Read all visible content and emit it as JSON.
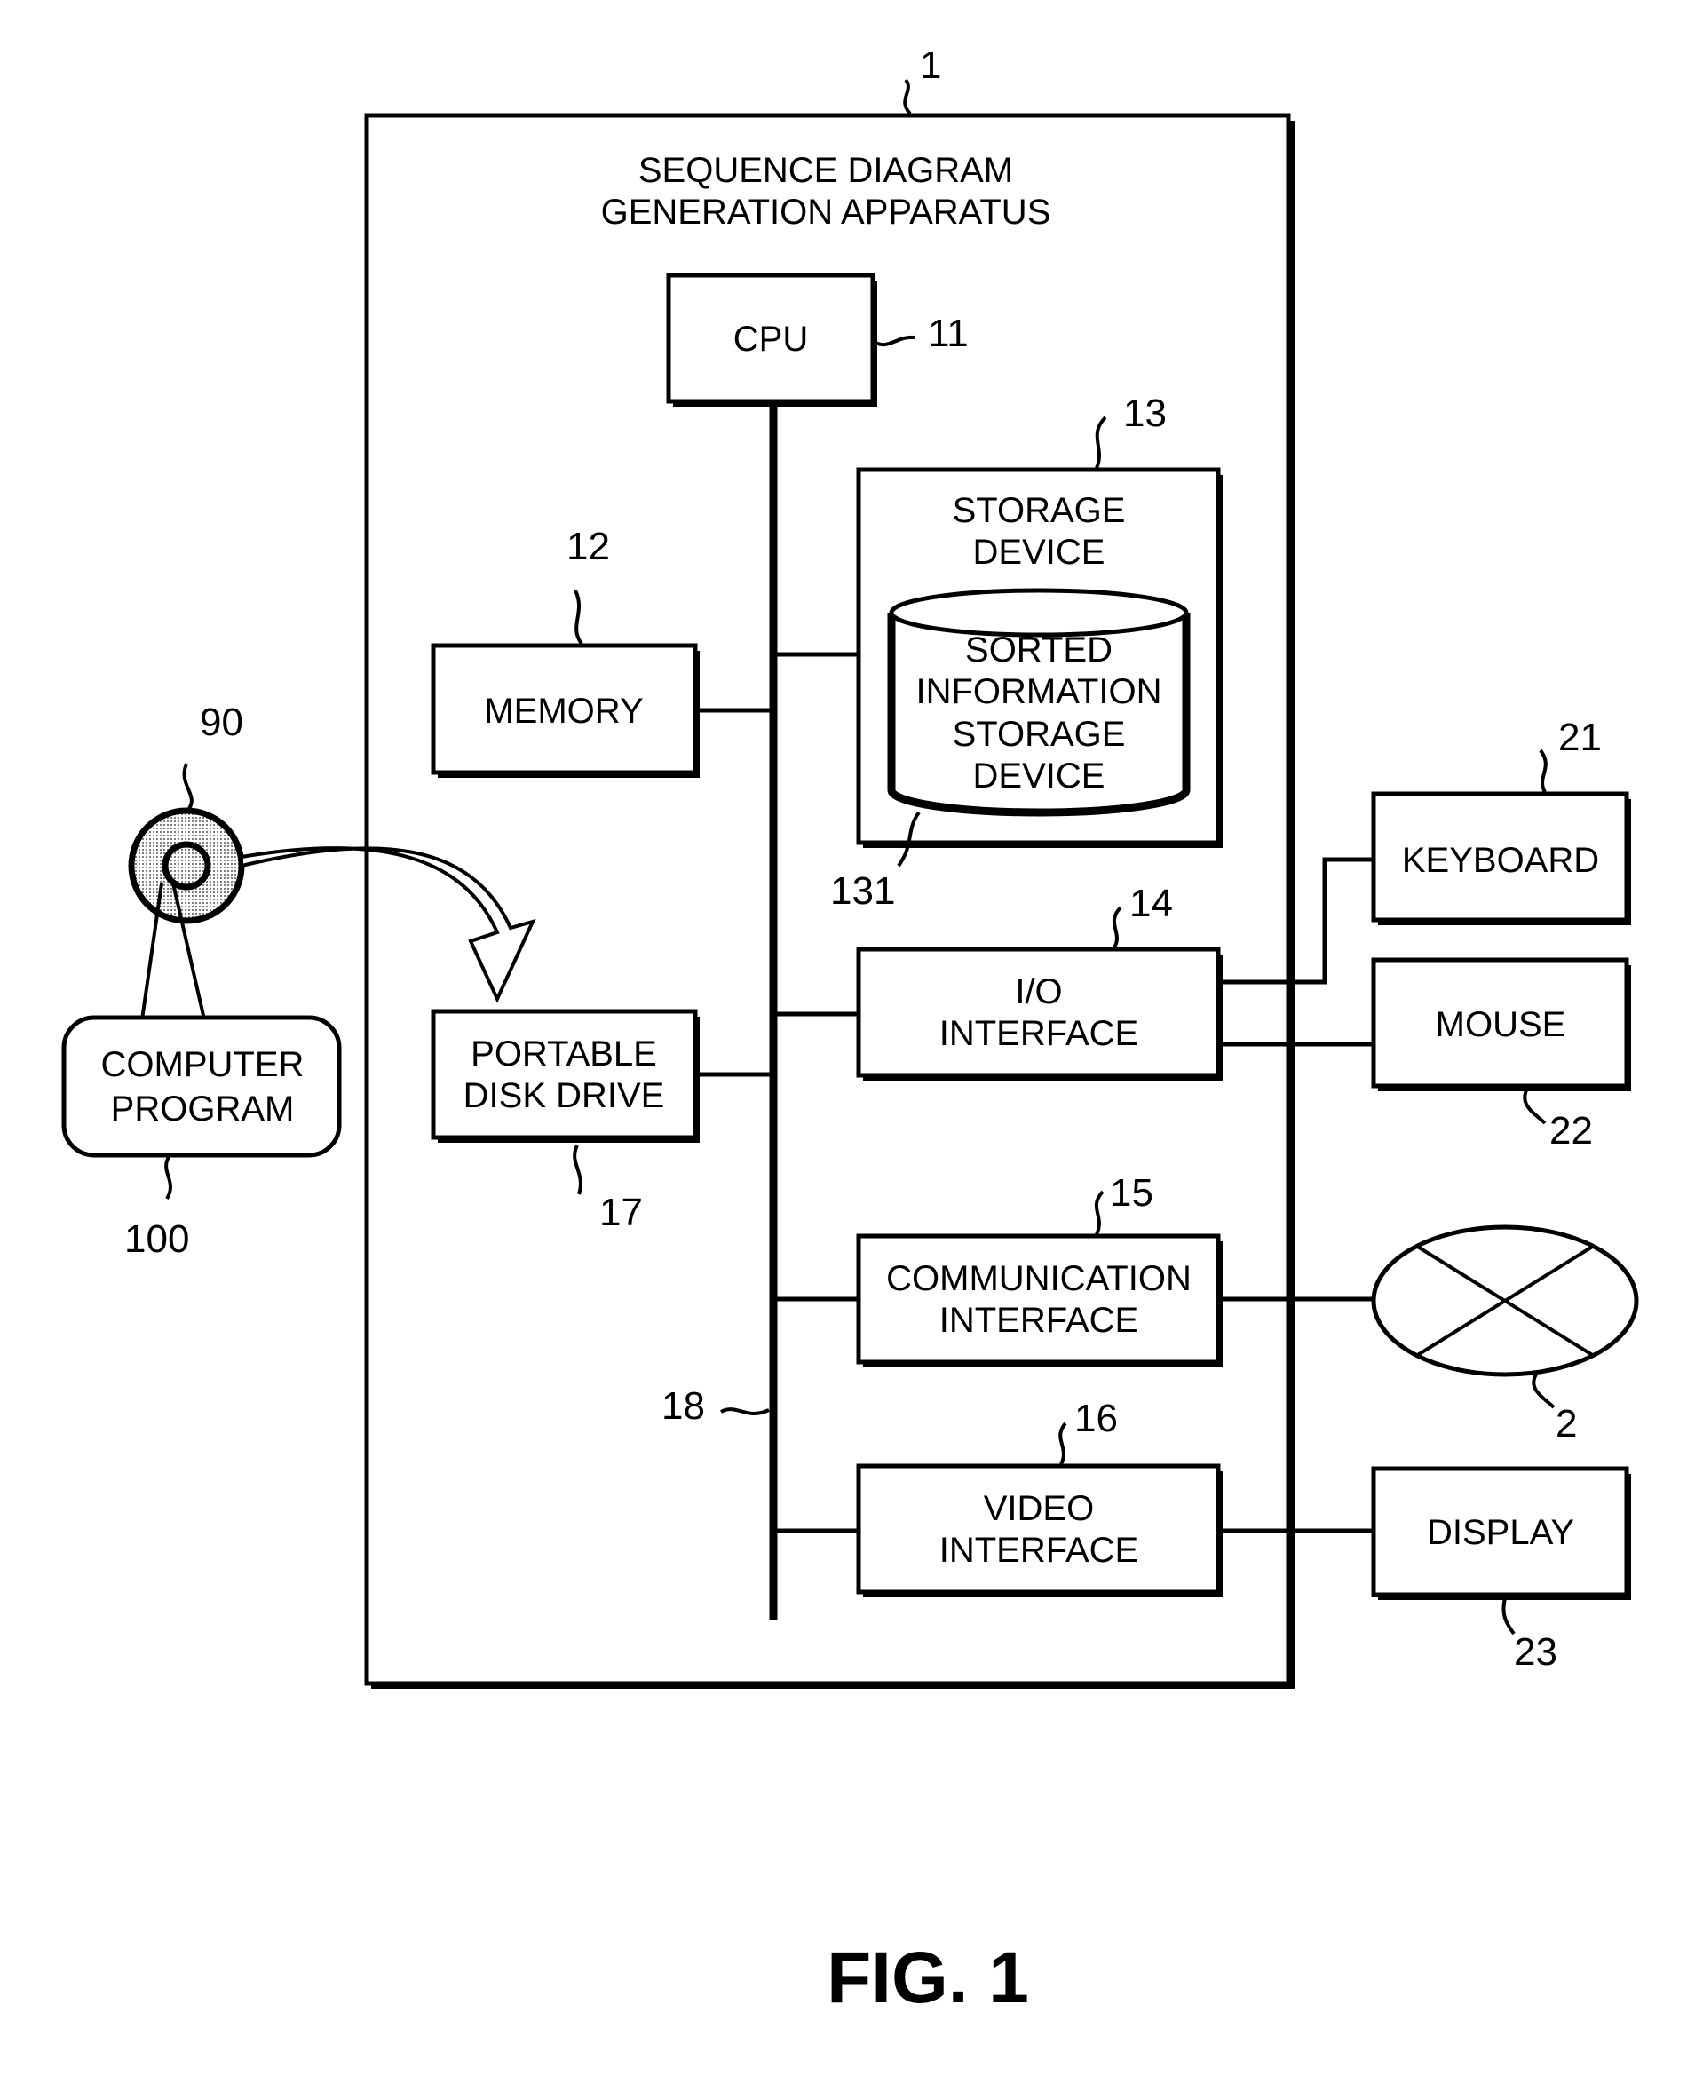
{
  "figure_label": "FIG. 1",
  "apparatus": {
    "ref": "1",
    "title": [
      "SEQUENCE DIAGRAM",
      "GENERATION APPARATUS"
    ]
  },
  "components": {
    "cpu": {
      "ref": "11",
      "label": [
        "CPU"
      ]
    },
    "memory": {
      "ref": "12",
      "label": [
        "MEMORY"
      ]
    },
    "storage": {
      "ref": "13",
      "label": [
        "STORAGE",
        "DEVICE"
      ]
    },
    "sorted_db": {
      "ref": "131",
      "label": [
        "SORTED",
        "INFORMATION",
        "STORAGE",
        "DEVICE"
      ]
    },
    "io": {
      "ref": "14",
      "label": [
        "I/O",
        "INTERFACE"
      ]
    },
    "comm": {
      "ref": "15",
      "label": [
        "COMMUNICATION",
        "INTERFACE"
      ]
    },
    "video": {
      "ref": "16",
      "label": [
        "VIDEO",
        "INTERFACE"
      ]
    },
    "disk_drive": {
      "ref": "17",
      "label": [
        "PORTABLE",
        "DISK DRIVE"
      ]
    },
    "bus": {
      "ref": "18"
    },
    "keyboard": {
      "ref": "21",
      "label": [
        "KEYBOARD"
      ]
    },
    "mouse": {
      "ref": "22",
      "label": [
        "MOUSE"
      ]
    },
    "display": {
      "ref": "23",
      "label": [
        "DISPLAY"
      ]
    },
    "network": {
      "ref": "2"
    },
    "disk": {
      "ref": "90"
    },
    "program": {
      "ref": "100",
      "label": [
        "COMPUTER",
        "PROGRAM"
      ]
    }
  }
}
